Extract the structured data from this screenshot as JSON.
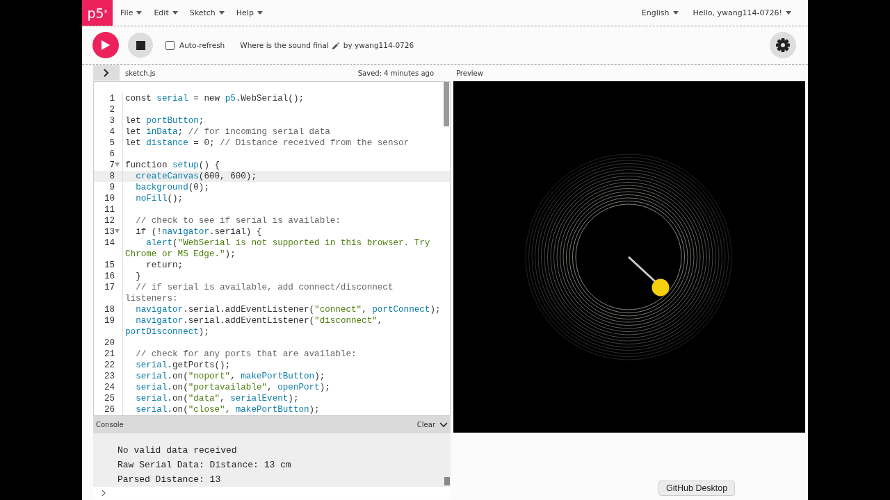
{
  "nav": {
    "logo": "p5$^{*}$",
    "menus": [
      "File",
      "Edit",
      "Sketch",
      "Help"
    ],
    "language": "English",
    "user": "Hello, ywang114-0726!"
  },
  "toolbar": {
    "auto_refresh": {
      "label": "Auto-refresh",
      "checked": false
    },
    "sketch_name": "Where is the sound final",
    "author": "by ywang114-0726"
  },
  "editor": {
    "file": "sketch.js",
    "saved": "Saved: 4 minutes ago",
    "lines": [
      {
        "number": "1",
        "code": [
          {
            "text": "const ",
            "kind": "plain"
          },
          {
            "text": "serial",
            "kind": "var"
          },
          {
            "text": " = new ",
            "kind": "plain"
          },
          {
            "text": "p5",
            "kind": "var"
          },
          {
            "text": ".WebSerial();",
            "kind": "plain"
          }
        ]
      },
      {
        "number": "2"
      },
      {
        "number": "3",
        "code": [
          {
            "text": "let ",
            "kind": "plain"
          },
          {
            "text": "portButton",
            "kind": "var"
          },
          {
            "text": ";",
            "kind": "plain"
          }
        ]
      },
      {
        "number": "4",
        "code": [
          {
            "text": "let ",
            "kind": "plain"
          },
          {
            "text": "inData",
            "kind": "var"
          },
          {
            "text": "; ",
            "kind": "plain"
          },
          {
            "text": "// for incoming serial data",
            "kind": "comment"
          }
        ]
      },
      {
        "number": "5",
        "code": [
          {
            "text": "let ",
            "kind": "plain"
          },
          {
            "text": "distance",
            "kind": "var"
          },
          {
            "text": " = 0; ",
            "kind": "plain"
          },
          {
            "text": "// Distance received from the sensor",
            "kind": "comment"
          }
        ]
      },
      {
        "number": "6"
      },
      {
        "number": "7",
        "foldable": true,
        "code": [
          {
            "text": "function ",
            "kind": "plain"
          },
          {
            "text": "setup",
            "kind": "var"
          },
          {
            "text": "() {",
            "kind": "plain"
          }
        ]
      },
      {
        "number": "8",
        "active": true,
        "code": [
          {
            "text": "  createCanvas",
            "kind": "var"
          },
          {
            "text": "(600, 600);",
            "kind": "plain"
          }
        ]
      },
      {
        "number": "9",
        "code": [
          {
            "text": "  background",
            "kind": "var"
          },
          {
            "text": "(0);",
            "kind": "plain"
          }
        ]
      },
      {
        "number": "10",
        "code": [
          {
            "text": "  noFill",
            "kind": "var"
          },
          {
            "text": "();",
            "kind": "plain"
          }
        ]
      },
      {
        "number": "11"
      },
      {
        "number": "12",
        "code": [
          {
            "text": "  // check to see if serial is available:",
            "kind": "comment"
          }
        ]
      },
      {
        "number": "13",
        "foldable": true,
        "code": [
          {
            "text": "  if (!",
            "kind": "plain"
          },
          {
            "text": "navigator",
            "kind": "var"
          },
          {
            "text": ".serial) {",
            "kind": "plain"
          }
        ]
      },
      {
        "number": "14",
        "code": [
          {
            "text": "    alert",
            "kind": "var"
          },
          {
            "text": "(",
            "kind": "plain"
          },
          {
            "text": "\"WebSerial is not supported in this browser. Try Chrome or MS Edge.\"",
            "kind": "string"
          },
          {
            "text": ");",
            "kind": "plain"
          }
        ]
      },
      {
        "number": "15",
        "code": [
          {
            "text": "    return;",
            "kind": "plain"
          }
        ]
      },
      {
        "number": "16",
        "code": [
          {
            "text": "  }",
            "kind": "plain"
          }
        ]
      },
      {
        "number": "17",
        "code": [
          {
            "text": "  // if serial is available, add connect/disconnect listeners:",
            "kind": "comment"
          }
        ]
      },
      {
        "number": "18",
        "code": [
          {
            "text": "  navigator",
            "kind": "var"
          },
          {
            "text": ".serial.addEventListener(",
            "kind": "plain"
          },
          {
            "text": "\"connect\"",
            "kind": "string"
          },
          {
            "text": ", ",
            "kind": "plain"
          },
          {
            "text": "portConnect",
            "kind": "var"
          },
          {
            "text": ");",
            "kind": "plain"
          }
        ]
      },
      {
        "number": "19",
        "code": [
          {
            "text": "  navigator",
            "kind": "var"
          },
          {
            "text": ".serial.addEventListener(",
            "kind": "plain"
          },
          {
            "text": "\"disconnect\"",
            "kind": "string"
          },
          {
            "text": ", ",
            "kind": "plain"
          },
          {
            "text": "portDisconnect",
            "kind": "var"
          },
          {
            "text": ");",
            "kind": "plain"
          }
        ]
      },
      {
        "number": "20"
      },
      {
        "number": "21",
        "code": [
          {
            "text": "  // check for any ports that are available:",
            "kind": "comment"
          }
        ]
      },
      {
        "number": "22",
        "code": [
          {
            "text": "  serial",
            "kind": "var"
          },
          {
            "text": ".getPorts();",
            "kind": "plain"
          }
        ]
      },
      {
        "number": "23",
        "code": [
          {
            "text": "  serial",
            "kind": "var"
          },
          {
            "text": ".on(",
            "kind": "plain"
          },
          {
            "text": "\"noport\"",
            "kind": "string"
          },
          {
            "text": ", ",
            "kind": "plain"
          },
          {
            "text": "makePortButton",
            "kind": "var"
          },
          {
            "text": ");",
            "kind": "plain"
          }
        ]
      },
      {
        "number": "24",
        "code": [
          {
            "text": "  serial",
            "kind": "var"
          },
          {
            "text": ".on(",
            "kind": "plain"
          },
          {
            "text": "\"portavailable\"",
            "kind": "string"
          },
          {
            "text": ", ",
            "kind": "plain"
          },
          {
            "text": "openPort",
            "kind": "var"
          },
          {
            "text": ");",
            "kind": "plain"
          }
        ]
      },
      {
        "number": "25",
        "code": [
          {
            "text": "  serial",
            "kind": "var"
          },
          {
            "text": ".on(",
            "kind": "plain"
          },
          {
            "text": "\"data\"",
            "kind": "string"
          },
          {
            "text": ", ",
            "kind": "plain"
          },
          {
            "text": "serialEvent",
            "kind": "var"
          },
          {
            "text": ");",
            "kind": "plain"
          }
        ]
      },
      {
        "number": "26",
        "code": [
          {
            "text": "  serial",
            "kind": "var"
          },
          {
            "text": ".on(",
            "kind": "plain"
          },
          {
            "text": "\"close\"",
            "kind": "string"
          },
          {
            "text": ", ",
            "kind": "plain"
          },
          {
            "text": "makePortButton",
            "kind": "var"
          },
          {
            "text": ");",
            "kind": "plain"
          }
        ]
      }
    ]
  },
  "console": {
    "title": "Console",
    "clear": "Clear",
    "messages": [
      "No valid data received",
      "Raw Serial Data:  Distance: 13 cm",
      "Parsed Distance:  13"
    ]
  },
  "preview": {
    "title": "Preview"
  },
  "tooltip": "GitHub Desktop"
}
